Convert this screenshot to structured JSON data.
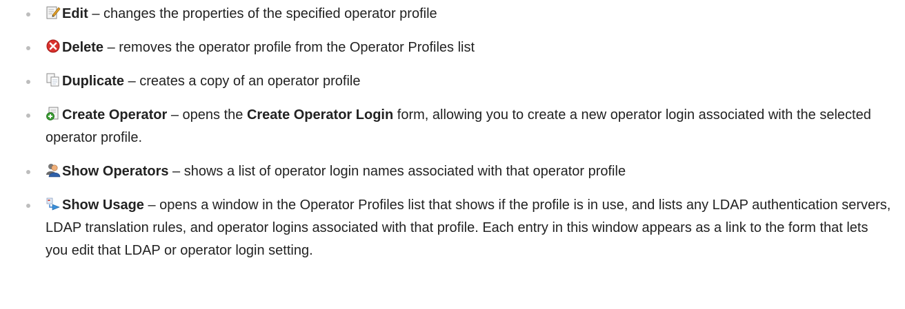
{
  "items": [
    {
      "icon": "edit-icon",
      "title": "Edit",
      "desc": " – changes the properties of the specified operator profile"
    },
    {
      "icon": "delete-icon",
      "title": "Delete",
      "desc": " – removes the operator profile from the Operator Profiles list"
    },
    {
      "icon": "duplicate-icon",
      "title": "Duplicate",
      "desc": " – creates a copy of an operator profile"
    },
    {
      "icon": "create-operator-icon",
      "title": "Create Operator",
      "desc_pre": " – opens the ",
      "desc_bold": "Create Operator Login",
      "desc_post": " form, allowing you to create a new operator login associated with the selected operator profile."
    },
    {
      "icon": "show-operators-icon",
      "title": "Show Operators",
      "desc": " – shows a list of operator login names associated with that operator profile"
    },
    {
      "icon": "show-usage-icon",
      "title": "Show Usage",
      "desc": " – opens a window in the Operator Profiles list that shows if the profile is in use, and lists any LDAP authentication servers, LDAP translation rules, and operator logins associated with that profile. Each entry in this window appears as a link to the form that lets you edit that LDAP or operator login setting."
    }
  ],
  "colors": {
    "text": "#222222",
    "bullet": "#bdbdbd",
    "delete_red": "#d9302c"
  }
}
